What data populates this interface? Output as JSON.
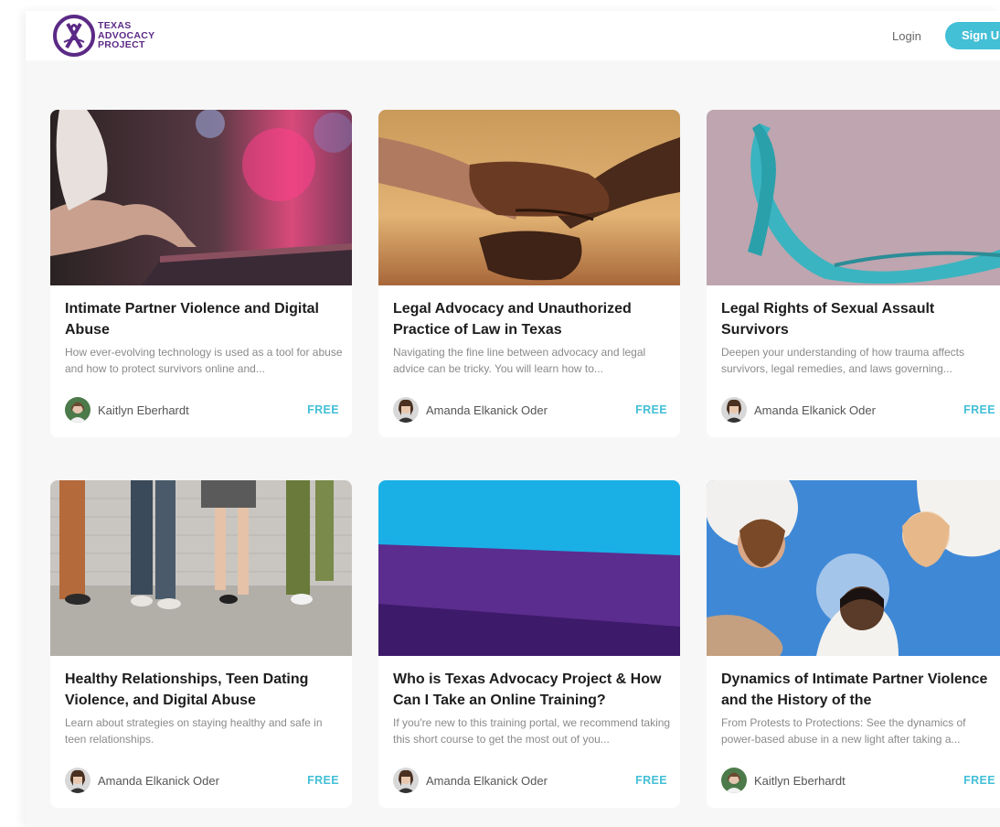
{
  "header": {
    "logo_lines": [
      "TEXAS",
      "ADVOCACY",
      "PROJECT"
    ],
    "login_label": "Login",
    "signup_label": "Sign Up"
  },
  "colors": {
    "accent": "#43bfd6",
    "brand_purple": "#5b2a86"
  },
  "courses": [
    {
      "title": "Intimate Partner Violence and Digital Abuse",
      "description": "How ever-evolving technology is used as a tool for abuse and how to protect survivors online and...",
      "author": "Kaitlyn Eberhardt",
      "price": "FREE"
    },
    {
      "title": "Legal Advocacy and Unauthorized Practice of Law in Texas",
      "description": "Navigating the fine line between advocacy and legal advice can be tricky. You will learn how to...",
      "author": "Amanda Elkanick Oder",
      "price": "FREE"
    },
    {
      "title": "Legal Rights of Sexual Assault Survivors",
      "description": "Deepen your understanding of how trauma affects survivors, legal remedies, and laws governing...",
      "author": "Amanda Elkanick Oder",
      "price": "FREE"
    },
    {
      "title": "Healthy Relationships, Teen Dating Violence, and Digital Abuse",
      "description": "Learn about strategies on staying healthy and safe in teen relationships.",
      "author": "Amanda Elkanick Oder",
      "price": "FREE"
    },
    {
      "title": "Who is Texas Advocacy Project & How Can I Take an Online Training?",
      "description": "If you're new to this training portal, we recommend taking this short course to get the most out of you...",
      "author": "Amanda Elkanick Oder",
      "price": "FREE"
    },
    {
      "title": "Dynamics of Intimate Partner Violence and the History of the",
      "description": "From Protests to Protections: See the dynamics of power-based abuse in a new light after taking a...",
      "author": "Kaitlyn Eberhardt",
      "price": "FREE"
    }
  ]
}
